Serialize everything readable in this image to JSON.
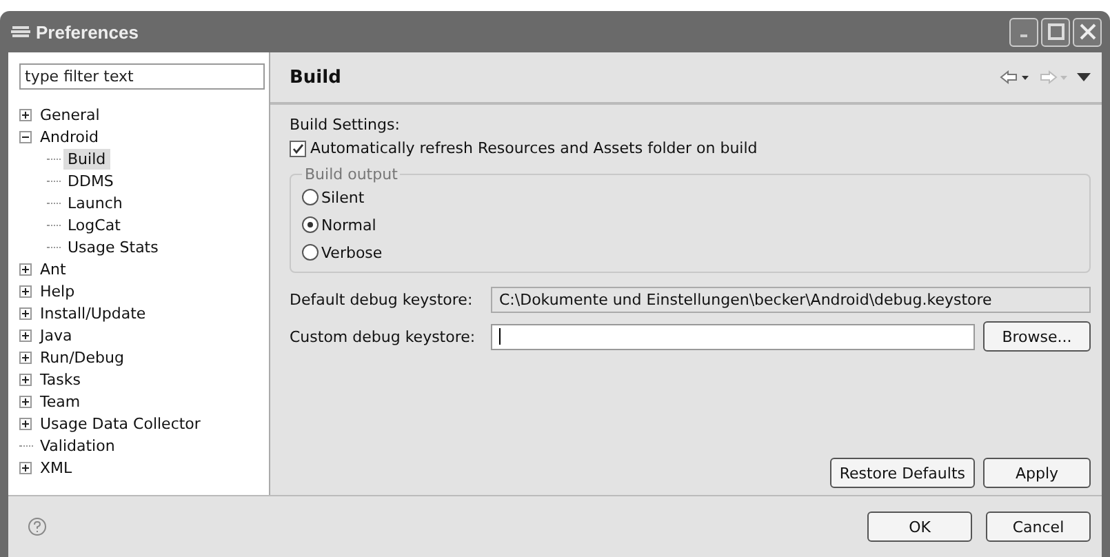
{
  "window": {
    "title": "Preferences"
  },
  "filter": {
    "placeholder": "type filter text"
  },
  "tree": [
    {
      "label": "General",
      "expandable": true,
      "expanded": false,
      "selected": false
    },
    {
      "label": "Android",
      "expandable": true,
      "expanded": true,
      "selected": false,
      "children": [
        {
          "label": "Build",
          "selected": true
        },
        {
          "label": "DDMS",
          "selected": false
        },
        {
          "label": "Launch",
          "selected": false
        },
        {
          "label": "LogCat",
          "selected": false
        },
        {
          "label": "Usage Stats",
          "selected": false
        }
      ]
    },
    {
      "label": "Ant",
      "expandable": true,
      "expanded": false,
      "selected": false
    },
    {
      "label": "Help",
      "expandable": true,
      "expanded": false,
      "selected": false
    },
    {
      "label": "Install/Update",
      "expandable": true,
      "expanded": false,
      "selected": false
    },
    {
      "label": "Java",
      "expandable": true,
      "expanded": false,
      "selected": false
    },
    {
      "label": "Run/Debug",
      "expandable": true,
      "expanded": false,
      "selected": false
    },
    {
      "label": "Tasks",
      "expandable": true,
      "expanded": false,
      "selected": false
    },
    {
      "label": "Team",
      "expandable": true,
      "expanded": false,
      "selected": false
    },
    {
      "label": "Usage Data Collector",
      "expandable": true,
      "expanded": false,
      "selected": false
    },
    {
      "label": "Validation",
      "expandable": false,
      "selected": false
    },
    {
      "label": "XML",
      "expandable": true,
      "expanded": false,
      "selected": false
    }
  ],
  "page": {
    "title": "Build",
    "section_label": "Build Settings:",
    "auto_refresh": {
      "label": "Automatically refresh Resources and Assets folder on build",
      "checked": true
    },
    "build_output": {
      "legend": "Build output",
      "options": [
        {
          "label": "Silent",
          "selected": false
        },
        {
          "label": "Normal",
          "selected": true
        },
        {
          "label": "Verbose",
          "selected": false
        }
      ]
    },
    "default_keystore": {
      "label": "Default debug keystore:",
      "value": "C:\\Dokumente und Einstellungen\\becker\\Android\\debug.keystore",
      "disabled": true
    },
    "custom_keystore": {
      "label": "Custom debug keystore:",
      "disabled": false
    },
    "browse": "Browse...",
    "restore": "Restore Defaults",
    "apply": "Apply"
  },
  "buttons": {
    "ok": "OK",
    "cancel": "Cancel"
  }
}
